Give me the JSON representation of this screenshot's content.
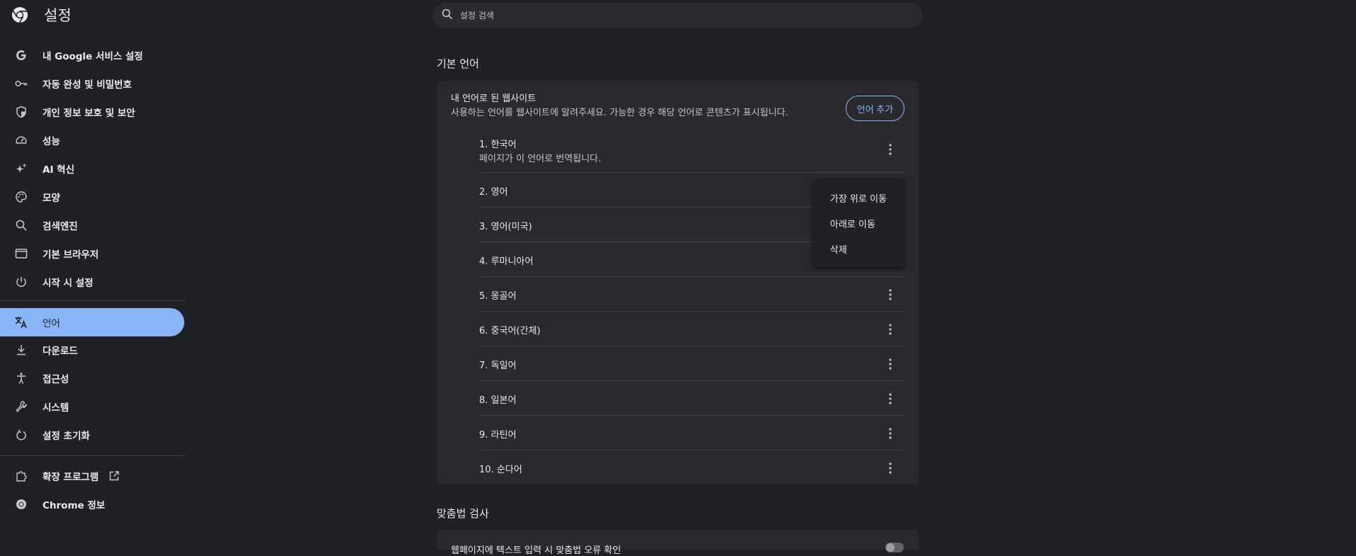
{
  "header": {
    "title": "설정",
    "search_placeholder": "설정 검색"
  },
  "sidebar": {
    "items": [
      {
        "label": "내 Google 서비스 설정",
        "icon": "google-g-icon"
      },
      {
        "label": "자동 완성 및 비밀번호",
        "icon": "key-icon"
      },
      {
        "label": "개인 정보 보호 및 보안",
        "icon": "shield-icon"
      },
      {
        "label": "성능",
        "icon": "speedometer-icon"
      },
      {
        "label": "AI 혁신",
        "icon": "sparkle-icon"
      },
      {
        "label": "모양",
        "icon": "palette-icon"
      },
      {
        "label": "검색엔진",
        "icon": "search-icon"
      },
      {
        "label": "기본 브라우저",
        "icon": "browser-window-icon"
      },
      {
        "label": "시작 시 설정",
        "icon": "power-icon"
      },
      {
        "label": "언어",
        "icon": "translate-icon",
        "active": true
      },
      {
        "label": "다운로드",
        "icon": "download-icon"
      },
      {
        "label": "접근성",
        "icon": "accessibility-icon"
      },
      {
        "label": "시스템",
        "icon": "wrench-icon"
      },
      {
        "label": "설정 초기화",
        "icon": "reset-icon"
      }
    ],
    "extensions_label": "확장 프로그램",
    "about_label": "Chrome 정보"
  },
  "main": {
    "section_title": "기본 언어",
    "card_heading": "내 언어로 된 웹사이트",
    "card_description": "사용하는 언어를 웹사이트에 알려주세요. 가능한 경우 해당 언어로 콘텐츠가 표시됩니다.",
    "add_language_label": "언어 추가",
    "languages": [
      {
        "label": "1. 한국어",
        "sub": "페이지가 이 언어로 번역됩니다."
      },
      {
        "label": "2. 영어"
      },
      {
        "label": "3. 영어(미국)"
      },
      {
        "label": "4. 루마니아어"
      },
      {
        "label": "5. 몽골어"
      },
      {
        "label": "6. 중국어(간체)"
      },
      {
        "label": "7. 독일어"
      },
      {
        "label": "8. 일본어"
      },
      {
        "label": "9. 라틴어"
      },
      {
        "label": "10. 순다어"
      }
    ],
    "context_menu": [
      "가장 위로 이동",
      "아래로 이동",
      "삭제"
    ],
    "spellcheck_title": "맞춤법 검사",
    "spellcheck_item": "웹페이지에 텍스트 입력 시 맞춤법 오류 확인"
  },
  "colors": {
    "background": "#202124",
    "card": "#292a2d",
    "accent": "#8ab4f8"
  }
}
